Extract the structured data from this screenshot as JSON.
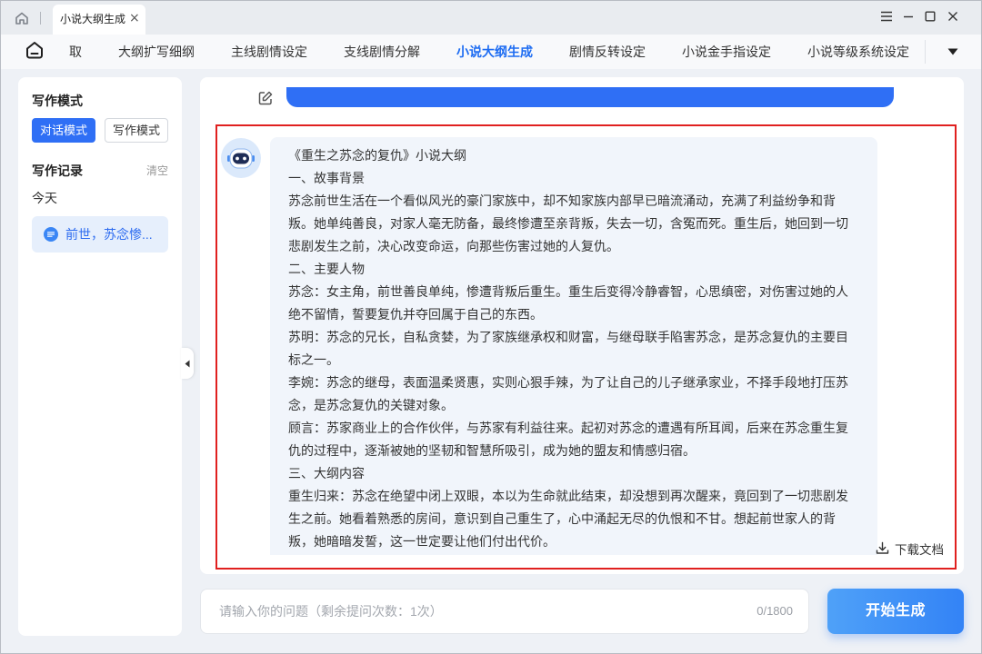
{
  "titlebar": {
    "tab_title": "小说大纲生成",
    "tab_close": "×"
  },
  "nav": {
    "tabs": [
      "取",
      "大纲扩写细纲",
      "主线剧情设定",
      "支线剧情分解",
      "小说大纲生成",
      "剧情反转设定",
      "小说金手指设定",
      "小说等级系统设定"
    ],
    "active_tab": "小说大纲生成"
  },
  "sidebar": {
    "mode_heading": "写作模式",
    "modes": [
      "对话模式",
      "写作模式"
    ],
    "active_mode": "对话模式",
    "history_heading": "写作记录",
    "clear_label": "清空",
    "group_label": "今天",
    "history_items": [
      "前世，苏念惨..."
    ]
  },
  "chat": {
    "bot_message": {
      "lines": [
        "《重生之苏念的复仇》小说大纲",
        "一、故事背景",
        "苏念前世生活在一个看似风光的豪门家族中，却不知家族内部早已暗流涌动，充满了利益纷争和背",
        "叛。她单纯善良，对家人毫无防备，最终惨遭至亲背叛，失去一切，含冤而死。重生后，她回到一切",
        "悲剧发生之前，决心改变命运，向那些伤害过她的人复仇。",
        "二、主要人物",
        "苏念：女主角，前世善良单纯，惨遭背叛后重生。重生后变得冷静睿智，心思缜密，对伤害过她的人",
        "绝不留情，誓要复仇并夺回属于自己的东西。",
        "苏明：苏念的兄长，自私贪婪，为了家族继承权和财富，与继母联手陷害苏念，是苏念复仇的主要目",
        "标之一。",
        "李婉：苏念的继母，表面温柔贤惠，实则心狠手辣，为了让自己的儿子继承家业，不择手段地打压苏",
        "念，是苏念复仇的关键对象。",
        "顾言：苏家商业上的合作伙伴，与苏家有利益往来。起初对苏念的遭遇有所耳闻，后来在苏念重生复",
        "仇的过程中，逐渐被她的坚韧和智慧所吸引，成为她的盟友和情感归宿。",
        "三、大纲内容",
        "重生归来：苏念在绝望中闭上双眼，本以为生命就此结束，却没想到再次醒来，竟回到了一切悲剧发",
        "生之前。她看着熟悉的房间，意识到自己重生了，心中涌起无尽的仇恨和不甘。想起前世家人的背",
        "叛，她暗暗发誓，这一世定要让他们付出代价。"
      ]
    },
    "download_label": "下载文档"
  },
  "input": {
    "placeholder": "请输入你的问题（剩余提问次数：1次）",
    "value": "",
    "counter": "0/1800"
  },
  "actions": {
    "generate_label": "开始生成"
  },
  "icons": {
    "titlebar": [
      "home-icon",
      "menu-icon",
      "minimize-icon",
      "maximize-icon",
      "close-icon"
    ],
    "nav": [
      "home-icon",
      "chevron-down-icon"
    ],
    "chat": [
      "edit-icon",
      "robot-avatar-icon",
      "download-icon"
    ],
    "sidebar": [
      "chat-history-icon",
      "chevron-left-icon"
    ]
  },
  "colors": {
    "accent": "#2f6ff5",
    "active_tab_text": "#1d6cf2",
    "bubble_background": "#f1f5fb",
    "annotation_border": "#e0201f"
  }
}
